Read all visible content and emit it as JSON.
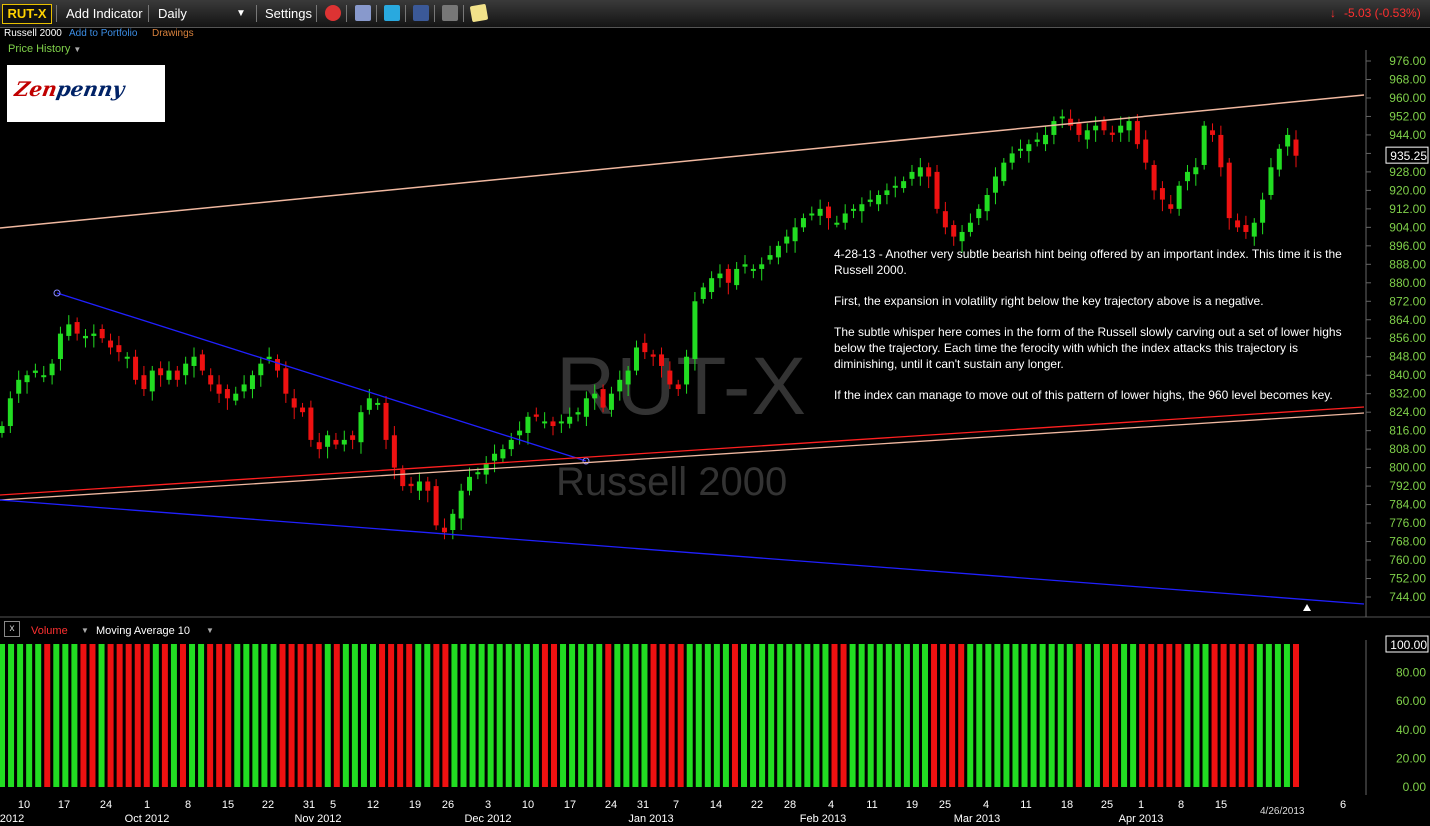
{
  "toolbar": {
    "symbol": "RUT-X",
    "add_indicator": "Add Indicator",
    "period": "Daily",
    "settings": "Settings",
    "change": "-5.03 (-0.53%)"
  },
  "subheader": {
    "name": "Russell 2000",
    "add_to_portfolio": "Add to Portfolio",
    "drawings": "Drawings"
  },
  "price_history_label": "Price History",
  "logo_text_a": "Zen",
  "logo_text_b": "penny",
  "watermark": {
    "symbol": "RUT-X",
    "name": "Russell 2000"
  },
  "annotation": {
    "p1": "4-28-13 - Another very subtle bearish hint being offered by an important index. This time it is the Russell 2000.",
    "p2": "First, the expansion in volatility right below the key trajectory above is a negative.",
    "p3": "The subtle whisper here comes in the form of the Russell slowly carving out a set of lower highs below the trajectory. Each time the ferocity with which the index attacks this trajectory is diminishing, until it can't sustain any longer.",
    "p4": "If the index can manage to move out of this pattern of lower highs, the 960 level becomes key."
  },
  "volume_panel": {
    "label": "Volume",
    "indicator": "Moving Average 10"
  },
  "date_stamp": "4/26/2013",
  "colors": {
    "up": "#22dd22",
    "down": "#ee1111",
    "axis_label": "#7fd04a",
    "upper_trend": "#f0b8a0",
    "lower_trend": "#2020ff",
    "mid_trend": "#ff2020"
  },
  "chart_data": [
    {
      "type": "candlestick",
      "title": "",
      "last_price": "935.25",
      "y_ticks": [
        "976.00",
        "968.00",
        "960.00",
        "952.00",
        "944.00",
        "936.00",
        "928.00",
        "920.00",
        "912.00",
        "904.00",
        "896.00",
        "888.00",
        "880.00",
        "872.00",
        "864.00",
        "856.00",
        "848.00",
        "840.00",
        "832.00",
        "824.00",
        "816.00",
        "808.00",
        "800.00",
        "792.00",
        "784.00",
        "776.00",
        "768.00",
        "760.00",
        "752.00",
        "744.00"
      ],
      "ylim": [
        738,
        982
      ],
      "x_day_ticks": [
        "10",
        "17",
        "24",
        "1",
        "8",
        "15",
        "22",
        "31",
        "5",
        "12",
        "19",
        "26",
        "3",
        "10",
        "17",
        "24",
        "31",
        "7",
        "14",
        "22",
        "28",
        "4",
        "11",
        "19",
        "25",
        "4",
        "11",
        "18",
        "25",
        "1",
        "8",
        "15",
        "6"
      ],
      "x_month_ticks": [
        "2012",
        "Oct 2012",
        "Nov 2012",
        "Dec 2012",
        "Jan 2013",
        "Feb 2013",
        "Mar 2013",
        "Apr 2013"
      ],
      "candles_close": [
        818,
        830,
        838,
        840,
        842,
        840,
        845,
        858,
        862,
        858,
        857,
        858,
        856,
        852,
        850,
        848,
        838,
        834,
        842,
        840,
        842,
        838,
        845,
        848,
        842,
        836,
        832,
        830,
        832,
        836,
        840,
        845,
        848,
        842,
        832,
        826,
        824,
        812,
        808,
        814,
        810,
        812,
        812,
        824,
        830,
        828,
        812,
        800,
        792,
        792,
        794,
        790,
        775,
        772,
        780,
        790,
        796,
        798,
        802,
        806,
        808,
        812,
        816,
        822,
        822,
        820,
        818,
        820,
        822,
        824,
        830,
        832,
        826,
        832,
        838,
        842,
        852,
        850,
        848,
        844,
        836,
        834,
        848,
        872,
        878,
        882,
        884,
        880,
        886,
        888,
        886,
        888,
        892,
        896,
        900,
        904,
        908,
        910,
        912,
        908,
        906,
        910,
        912,
        914,
        916,
        918,
        920,
        922,
        924,
        928,
        930,
        926,
        912,
        904,
        900,
        902,
        906,
        912,
        918,
        926,
        932,
        936,
        938,
        940,
        942,
        944,
        950,
        952,
        948,
        944,
        946,
        948,
        946,
        944,
        948,
        950,
        940,
        932,
        920,
        916,
        912,
        922,
        928,
        930,
        948,
        944,
        930,
        908,
        904,
        902,
        906,
        916,
        930,
        938,
        944,
        935
      ]
    },
    {
      "type": "bar",
      "title": "Volume",
      "y_ticks": [
        "100.00",
        "80.00",
        "60.00",
        "40.00",
        "20.00",
        "0.00"
      ],
      "ylim": [
        0,
        100
      ],
      "colors_sequence": "alternating red/green by daily direction"
    }
  ]
}
